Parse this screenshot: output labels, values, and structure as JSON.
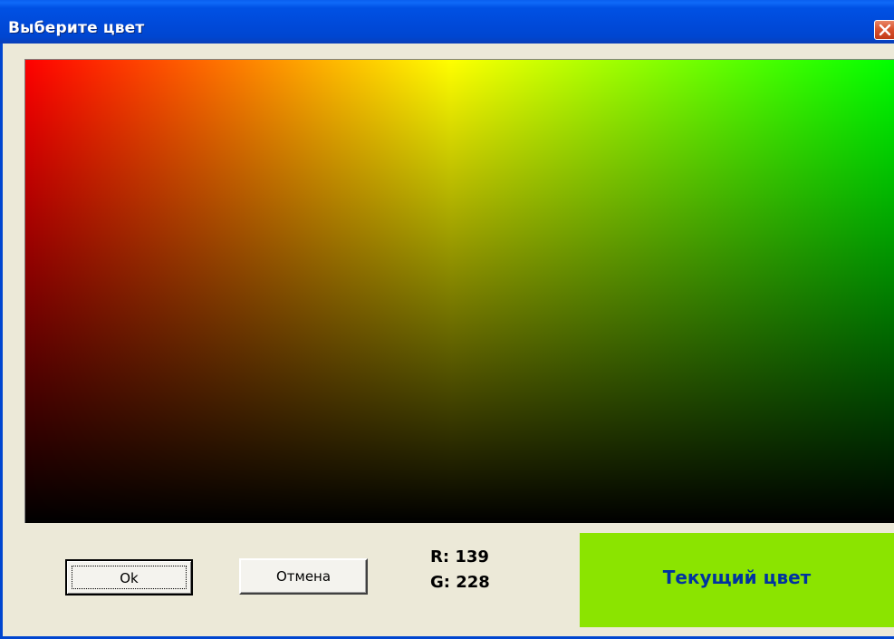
{
  "window": {
    "title": "Выберите цвет"
  },
  "buttons": {
    "ok_label": "Ok",
    "cancel_label": "Отмена"
  },
  "readout": {
    "r_line": "R: 139",
    "g_line": "G: 228"
  },
  "current_color": {
    "label": "Текущий цвет",
    "swatch_hex": "#8be400",
    "label_color_hex": "#0033a0"
  },
  "palette": {
    "gradient_stops_top": [
      "#ff0000",
      "#ffff00",
      "#00ff00"
    ],
    "bottom_color": "#000000"
  },
  "icons": {
    "close": "close-x-icon"
  }
}
